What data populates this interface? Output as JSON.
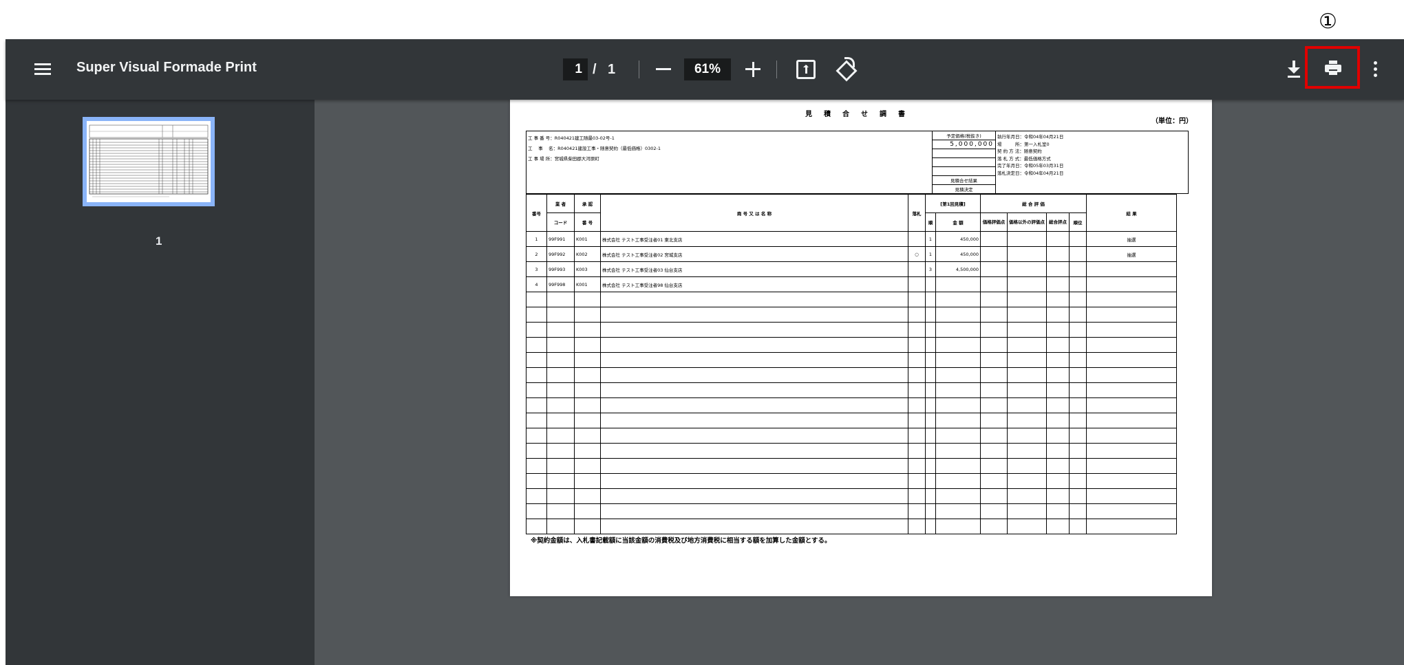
{
  "annotation": "①",
  "toolbar": {
    "title": "Super Visual Formade Print",
    "page_current": "1",
    "page_sep": "/",
    "page_total": "1",
    "zoom": "61%"
  },
  "sidebar": {
    "thumb_label": "1"
  },
  "colors": {
    "print_highlight": "#e00000",
    "toolbar_bg": "#323639",
    "canvas_bg": "#525659",
    "thumb_border": "#8ab4f8"
  },
  "icons": [
    "menu-icon",
    "zoom-out-icon",
    "zoom-in-icon",
    "fit-page-icon",
    "rotate-icon",
    "download-icon",
    "print-icon",
    "more-vert-icon"
  ],
  "document": {
    "title": "見積合せ調書",
    "unit": "（単位：円）",
    "header_left": [
      "工 事 番 号：R040421建工随最03-02号-1",
      "工　 事　 名：R040421建設工事・随意契約（最低価格）0302-1",
      "工 事 場 所：宮城県柴田郡大河原町"
    ],
    "header_mid": [
      "予定価格(税抜き)",
      "5,000,000",
      "",
      "",
      "",
      "見積合せ結果",
      "見積決定"
    ],
    "header_right": [
      "執行年月日：令和04年04月21日",
      "場　　　所：第一入札室0",
      "契 約 方 法：随意契約",
      "落 札 方 式：最低価格方式",
      "完了年月日：令和05年03月31日",
      "落札決定日：令和04年04月21日"
    ],
    "columns": {
      "no": "番号",
      "code_top": "業 者",
      "code_bottom": "コード",
      "approval_top": "承 認",
      "approval_bottom": "番 号",
      "name": "商 号 又 は 名 称",
      "award": "落札",
      "round": "[第1回見積]",
      "round_no": "順",
      "amount": "金 額",
      "eval": "総 合 評 価",
      "price_score": "価格評価点",
      "other_score": "価格以外の評価点",
      "total_score": "総合評点",
      "rank": "順位",
      "result": "結 果"
    },
    "rows": [
      {
        "no": "1",
        "code": "99F991",
        "approval": "K001",
        "name": "株式会社 テスト工事受注者01 東北支店",
        "award": "",
        "round": "1",
        "amount": "450,000",
        "result": "抽選"
      },
      {
        "no": "2",
        "code": "99F992",
        "approval": "K002",
        "name": "株式会社 テスト工事受注者02 宮城支店",
        "award": "○",
        "round": "1",
        "amount": "450,000",
        "result": "抽選"
      },
      {
        "no": "3",
        "code": "99F993",
        "approval": "K003",
        "name": "株式会社 テスト工事受注者03 仙台支店",
        "award": "",
        "round": "3",
        "amount": "4,500,000",
        "result": ""
      },
      {
        "no": "4",
        "code": "99F998",
        "approval": "K001",
        "name": "株式会社 テスト工事受注者98 仙台支店",
        "award": "",
        "round": "",
        "amount": "",
        "result": ""
      }
    ],
    "note": "※契約金額は、入札書記載額に当該金額の消費税及び地方消費税に相当する額を加算した金額とする。"
  }
}
